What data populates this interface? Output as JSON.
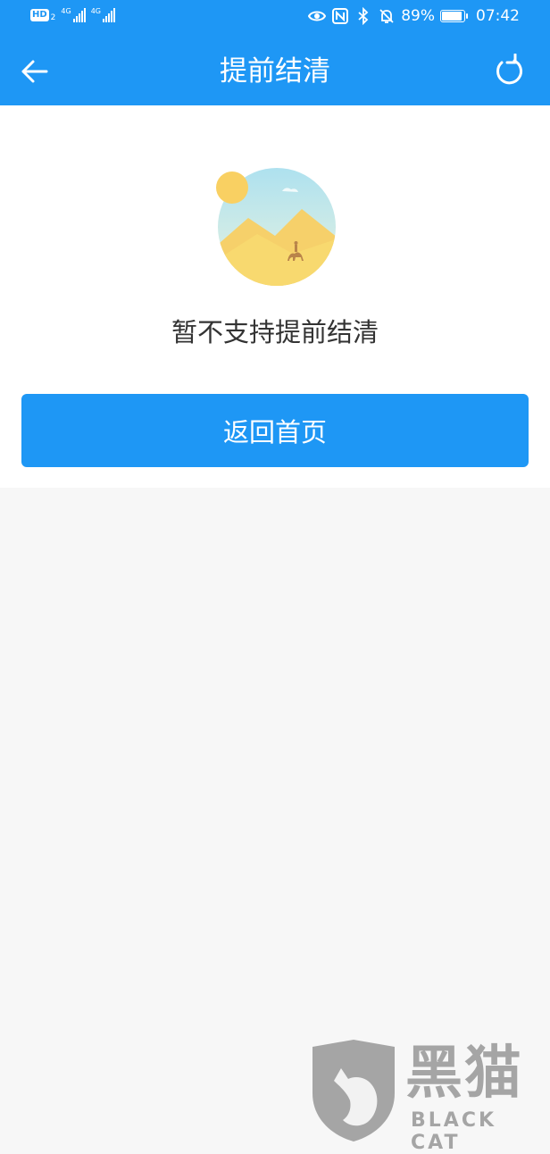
{
  "status_bar": {
    "hd_label": "HD",
    "hd_sub": "2",
    "signal1_label": "4G",
    "signal2_label": "4G",
    "battery_percent": "89%",
    "time": "07:42"
  },
  "nav": {
    "title": "提前结清"
  },
  "empty_state": {
    "message": "暂不支持提前结清",
    "button_label": "返回首页"
  },
  "watermark": {
    "brand": "黑猫",
    "brand_en": "BLACK CAT"
  },
  "colors": {
    "accent": "#1e97f5",
    "background": "#f7f7f7"
  }
}
